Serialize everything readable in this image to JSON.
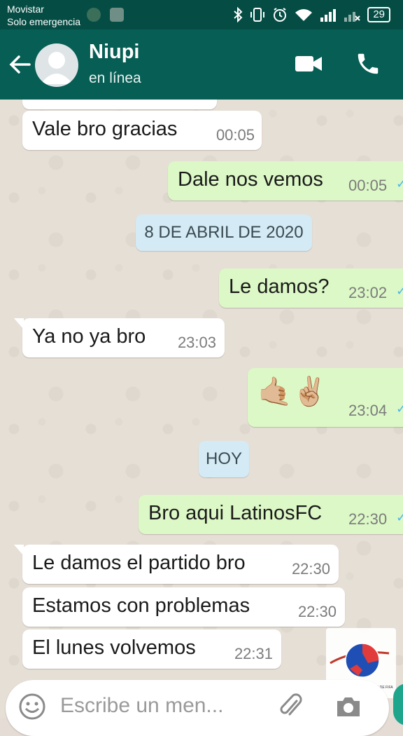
{
  "status_bar": {
    "carrier": "Movistar",
    "network_status": "Solo emergencia",
    "battery": "29",
    "icons": [
      "bluetooth-icon",
      "vibrate-icon",
      "alarm-icon",
      "wifi-icon",
      "signal-icon",
      "signal-x-icon",
      "battery-icon"
    ]
  },
  "header": {
    "contact_name": "Niupi",
    "contact_status": "en línea",
    "icons": [
      "back-arrow-icon",
      "avatar-icon",
      "video-call-icon",
      "phone-icon"
    ]
  },
  "messages": [
    {
      "direction": "in",
      "text": "Vale bro gracias",
      "time": "00:05"
    },
    {
      "direction": "out",
      "text": "Dale nos vemos",
      "time": "00:05"
    },
    {
      "type": "date",
      "text": "8 DE ABRIL DE 2020"
    },
    {
      "direction": "out",
      "text": "Le damos?",
      "time": "23:02"
    },
    {
      "direction": "in",
      "text": "Ya no ya bro",
      "time": "23:03"
    },
    {
      "direction": "out",
      "text": "🤙🏼✌🏼",
      "time": "23:04"
    },
    {
      "type": "date",
      "text": "HOY"
    },
    {
      "direction": "out",
      "text": "Bro aqui LatinosFC",
      "time": "22:30"
    },
    {
      "direction": "in",
      "text": "Le damos el partido bro",
      "time": "22:30"
    },
    {
      "direction": "in",
      "text": "Estamos con problemas",
      "time": "22:30"
    },
    {
      "direction": "in",
      "text": "El lunes volvemos",
      "time": "22:31"
    }
  ],
  "input": {
    "placeholder": "Escribe un men..."
  },
  "watermark": {
    "caption": "LIGA COMPETITIVA AMATEUR DE FIFA"
  },
  "colors": {
    "header": "#075e54",
    "status_bar": "#054d44",
    "outgoing_bubble": "#dcf8c6",
    "incoming_bubble": "#ffffff",
    "read_check": "#4fb6ec",
    "date_chip": "#d4eaf4"
  }
}
